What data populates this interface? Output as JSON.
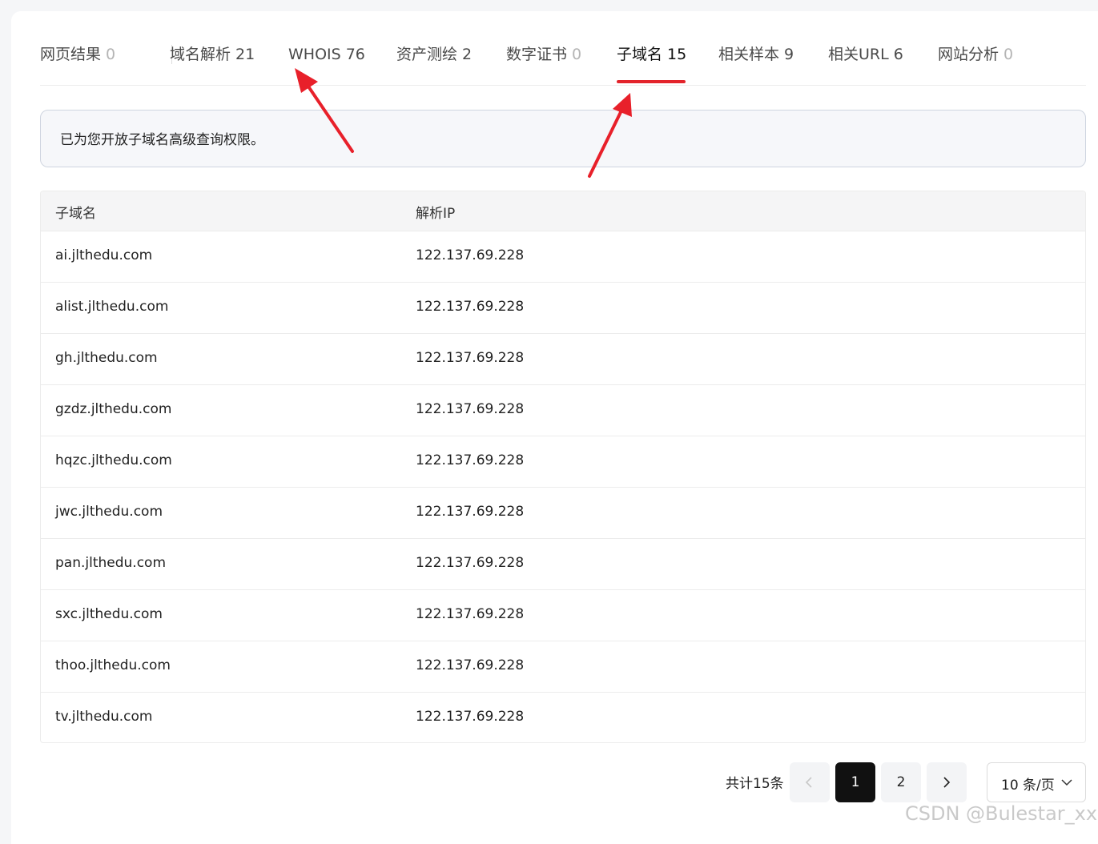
{
  "tabs": [
    {
      "label": "网页结果",
      "count": "0"
    },
    {
      "label": "域名解析",
      "count": "21"
    },
    {
      "label": "WHOIS",
      "count": "76"
    },
    {
      "label": "资产测绘",
      "count": "2"
    },
    {
      "label": "数字证书",
      "count": "0"
    },
    {
      "label": "子域名",
      "count": "15"
    },
    {
      "label": "相关样本",
      "count": "9"
    },
    {
      "label": "相关URL",
      "count": "6"
    },
    {
      "label": "网站分析",
      "count": "0"
    }
  ],
  "active_tab": "子域名",
  "notice": "已为您开放子域名高级查询权限。",
  "table": {
    "headers": [
      "子域名",
      "解析IP"
    ],
    "rows": [
      [
        "ai.jlthedu.com",
        "122.137.69.228"
      ],
      [
        "alist.jlthedu.com",
        "122.137.69.228"
      ],
      [
        "gh.jlthedu.com",
        "122.137.69.228"
      ],
      [
        "gzdz.jlthedu.com",
        "122.137.69.228"
      ],
      [
        "hqzc.jlthedu.com",
        "122.137.69.228"
      ],
      [
        "jwc.jlthedu.com",
        "122.137.69.228"
      ],
      [
        "pan.jlthedu.com",
        "122.137.69.228"
      ],
      [
        "sxc.jlthedu.com",
        "122.137.69.228"
      ],
      [
        "thoo.jlthedu.com",
        "122.137.69.228"
      ],
      [
        "tv.jlthedu.com",
        "122.137.69.228"
      ]
    ]
  },
  "pagination": {
    "total_text": "共计15条",
    "pages": [
      "1",
      "2"
    ],
    "current_page": "1",
    "page_size": "10 条/页",
    "prev_icon": "chevron-left-icon",
    "next_icon": "chevron-right-icon"
  },
  "watermark": "CSDN @Bulestar_xx",
  "colors": {
    "accent": "#e3242b",
    "annotation_arrow": "#e8202a"
  }
}
